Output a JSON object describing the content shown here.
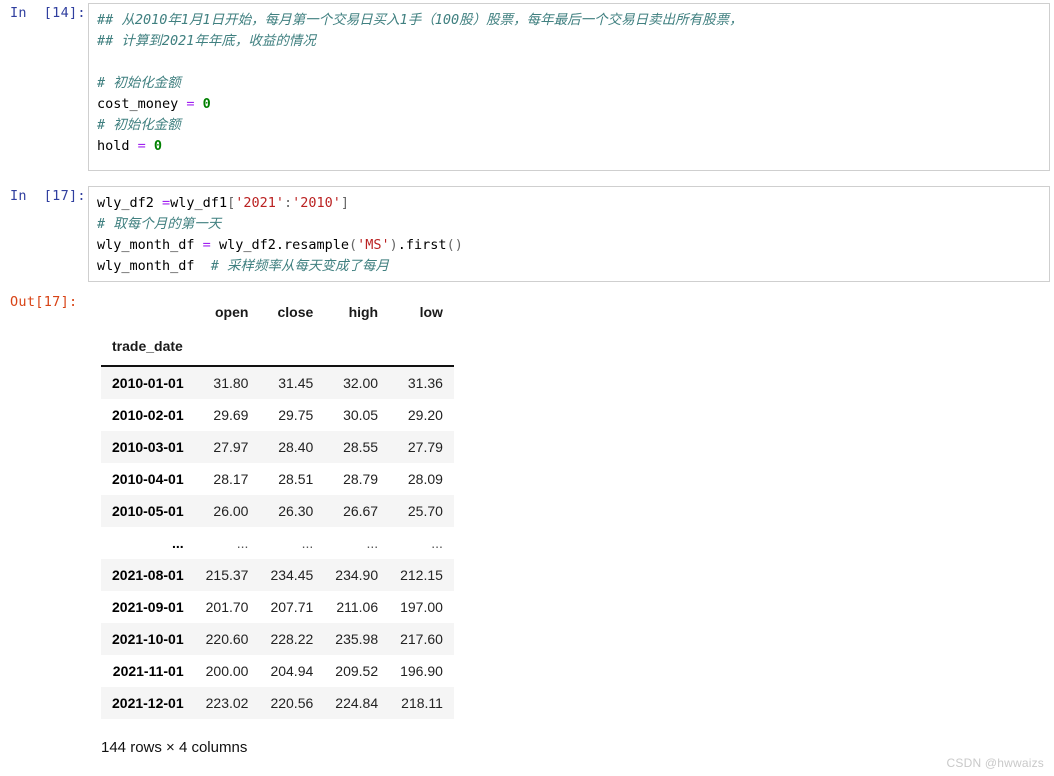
{
  "cells": [
    {
      "prompt": "In  [14]:",
      "type": "input",
      "lines": [
        "## 从2010年1月1日开始，每月第一个交易日买入1手（100股）股票，每年最后一个交易日卖出所有股票，",
        "## 计算到2021年年底，收益的情况",
        "",
        "# 初始化金额",
        "cost_money = 0",
        "# 初始化金额",
        "hold = 0"
      ],
      "tokens": {
        "comment1": "## 从2010年1月1日开始，每月第一个交易日买入1手（100股）股票，每年最后一个交易日卖出所有股票，",
        "comment2": "## 计算到2021年年底，收益的情况",
        "comment3": "# 初始化金额",
        "var1": "cost_money ",
        "eq1": "=",
        "num1": " 0",
        "comment4": "# 初始化金额",
        "var2": "hold ",
        "eq2": "=",
        "num2": " 0"
      }
    },
    {
      "prompt": "In  [17]:",
      "type": "input",
      "tokens": {
        "l1_a": "wly_df2 ",
        "l1_eq": "=",
        "l1_b": "wly_df1",
        "l1_br1": "[",
        "l1_s1": "'2021'",
        "l1_colon": ":",
        "l1_s2": "'2010'",
        "l1_br2": "]",
        "l2_comment": "# 取每个月的第一天",
        "l3_a": "wly_month_df ",
        "l3_eq": "=",
        "l3_b": " wly_df2.resample",
        "l3_br1": "(",
        "l3_s1": "'MS'",
        "l3_br2": ")",
        "l3_c": ".first",
        "l3_br3": "()",
        "l4_a": "wly_month_df  ",
        "l4_comment": "# 采样频率从每天变成了每月"
      }
    }
  ],
  "output": {
    "prompt": "Out[17]:",
    "table": {
      "index_name": "trade_date",
      "columns": [
        "open",
        "close",
        "high",
        "low"
      ],
      "rows": [
        {
          "index": "2010-01-01",
          "values": [
            "31.80",
            "31.45",
            "32.00",
            "31.36"
          ]
        },
        {
          "index": "2010-02-01",
          "values": [
            "29.69",
            "29.75",
            "30.05",
            "29.20"
          ]
        },
        {
          "index": "2010-03-01",
          "values": [
            "27.97",
            "28.40",
            "28.55",
            "27.79"
          ]
        },
        {
          "index": "2010-04-01",
          "values": [
            "28.17",
            "28.51",
            "28.79",
            "28.09"
          ]
        },
        {
          "index": "2010-05-01",
          "values": [
            "26.00",
            "26.30",
            "26.67",
            "25.70"
          ]
        },
        {
          "index": "...",
          "values": [
            "...",
            "...",
            "...",
            "..."
          ],
          "ellipsis": true
        },
        {
          "index": "2021-08-01",
          "values": [
            "215.37",
            "234.45",
            "234.90",
            "212.15"
          ]
        },
        {
          "index": "2021-09-01",
          "values": [
            "201.70",
            "207.71",
            "211.06",
            "197.00"
          ]
        },
        {
          "index": "2021-10-01",
          "values": [
            "220.60",
            "228.22",
            "235.98",
            "217.60"
          ]
        },
        {
          "index": "2021-11-01",
          "values": [
            "200.00",
            "204.94",
            "209.52",
            "196.90"
          ]
        },
        {
          "index": "2021-12-01",
          "values": [
            "223.02",
            "220.56",
            "224.84",
            "218.11"
          ]
        }
      ]
    },
    "shape_text": "144 rows × 4 columns"
  },
  "watermark": "CSDN @hwwaizs",
  "colors": {
    "prompt_in": "#303f9f",
    "prompt_out": "#d84315",
    "comment": "#408080",
    "operator": "#a020f0",
    "number": "#008000",
    "string": "#ba2121",
    "cell_border": "#cfcfcf",
    "row_stripe": "#f5f5f5",
    "watermark": "#c9c9c9"
  }
}
